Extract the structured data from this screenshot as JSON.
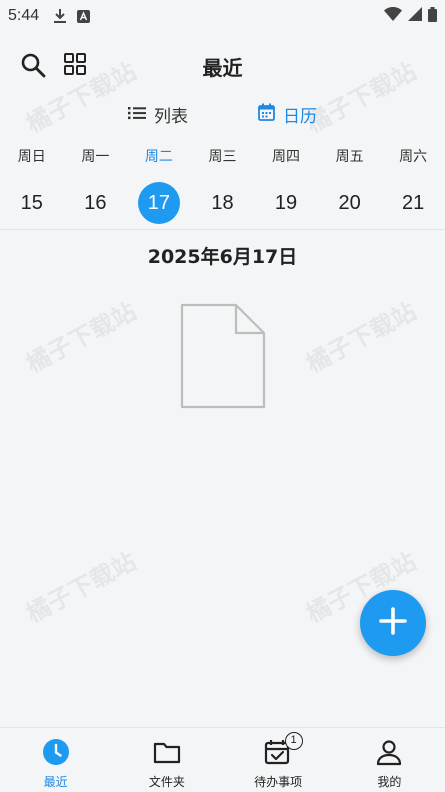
{
  "status_bar": {
    "time": "5:44"
  },
  "header": {
    "title": "最近"
  },
  "view_toggle": {
    "list_label": "列表",
    "calendar_label": "日历",
    "selected": "calendar"
  },
  "week": {
    "days": [
      "周日",
      "周一",
      "周二",
      "周三",
      "周四",
      "周五",
      "周六"
    ],
    "dates": [
      "15",
      "16",
      "17",
      "18",
      "19",
      "20",
      "21"
    ],
    "selected_index": 2
  },
  "selected_date": "2025年6月17日",
  "watermark": "橘子下载站",
  "colors": {
    "accent": "#1e9af0",
    "accent_text": "#1e88e5",
    "background": "#f4f5f6"
  },
  "bottom_nav": {
    "items": [
      {
        "label": "最近",
        "icon": "clock-icon",
        "active": true
      },
      {
        "label": "文件夹",
        "icon": "folder-icon",
        "active": false
      },
      {
        "label": "待办事项",
        "icon": "calendar-check-icon",
        "active": false,
        "badge": "1"
      },
      {
        "label": "我的",
        "icon": "person-icon",
        "active": false
      }
    ]
  }
}
